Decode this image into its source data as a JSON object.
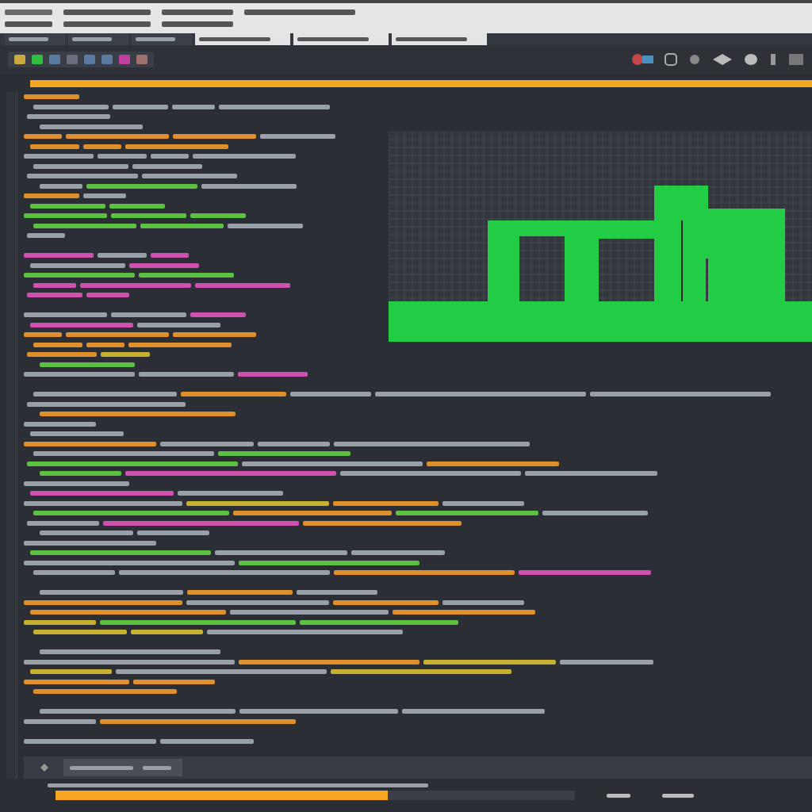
{
  "title_bar": {
    "rows": [
      {
        "segments": [
          {
            "color": "#6a6a6a"
          },
          {
            "color": "#555555"
          },
          {
            "color": "#555555"
          },
          {
            "color": "#555555"
          }
        ]
      },
      {
        "segments": [
          {
            "color": "#555555"
          },
          {
            "color": "#555555"
          },
          {
            "color": "#555555"
          }
        ]
      }
    ]
  },
  "tabs": [
    {
      "kind": "dark"
    },
    {
      "kind": "dark"
    },
    {
      "kind": "dark"
    },
    {
      "kind": "light"
    },
    {
      "kind": "light"
    },
    {
      "kind": "light"
    }
  ],
  "toolbar": {
    "buttons": [
      {
        "color": "#c8a840"
      },
      {
        "color": "#30c040"
      },
      {
        "color": "#5a7aa0"
      },
      {
        "color": "#6a6f80"
      },
      {
        "color": "#5a7aa0"
      },
      {
        "color": "#5a7aa0"
      },
      {
        "color": "#c040a0"
      },
      {
        "color": "#a07070"
      }
    ]
  },
  "editor": {
    "top_lines": [
      {
        "segments": [
          {
            "color": "#e0902a"
          }
        ]
      },
      {
        "segments": [
          {
            "color": "#9aa0a8"
          },
          {
            "color": "#9aa0a8"
          },
          {
            "color": "#9aa0a8"
          },
          {
            "color": "#9aa0a8"
          }
        ]
      },
      {
        "segments": [
          {
            "color": "#9aa0a8"
          }
        ]
      },
      {
        "segments": [
          {
            "color": "#9aa0a8"
          }
        ]
      },
      {
        "segments": [
          {
            "color": "#e0902a"
          },
          {
            "color": "#e0902a"
          },
          {
            "color": "#e0902a"
          },
          {
            "color": "#9aa0a8"
          }
        ]
      },
      {
        "segments": [
          {
            "color": "#e0902a"
          },
          {
            "color": "#e0902a"
          },
          {
            "color": "#e0902a"
          }
        ]
      },
      {
        "segments": [
          {
            "color": "#9aa0a8"
          },
          {
            "color": "#9aa0a8"
          },
          {
            "color": "#9aa0a8"
          },
          {
            "color": "#9aa0a8"
          }
        ]
      },
      {
        "segments": [
          {
            "color": "#9aa0a8"
          },
          {
            "color": "#9aa0a8"
          }
        ]
      },
      {
        "segments": [
          {
            "color": "#9aa0a8"
          },
          {
            "color": "#9aa0a8"
          }
        ]
      },
      {
        "segments": [
          {
            "color": "#9aa0a8"
          },
          {
            "color": "#5cc040"
          },
          {
            "color": "#9aa0a8"
          }
        ]
      },
      {
        "segments": [
          {
            "color": "#e0902a"
          },
          {
            "color": "#9aa0a8"
          }
        ]
      },
      {
        "segments": [
          {
            "color": "#5cc040"
          },
          {
            "color": "#5cc040"
          }
        ]
      },
      {
        "segments": [
          {
            "color": "#5cc040"
          },
          {
            "color": "#5cc040"
          },
          {
            "color": "#5cc040"
          }
        ]
      },
      {
        "segments": [
          {
            "color": "#5cc040"
          },
          {
            "color": "#5cc040"
          },
          {
            "color": "#9aa0a8"
          }
        ]
      },
      {
        "segments": [
          {
            "color": "#9aa0a8"
          }
        ]
      },
      {
        "kind": "blank"
      },
      {
        "segments": [
          {
            "color": "#d050b0"
          },
          {
            "color": "#9aa0a8"
          },
          {
            "color": "#d050b0"
          }
        ]
      },
      {
        "segments": [
          {
            "color": "#9aa0a8"
          },
          {
            "color": "#d050b0"
          }
        ]
      },
      {
        "segments": [
          {
            "color": "#5cc040"
          },
          {
            "color": "#5cc040"
          }
        ]
      },
      {
        "segments": [
          {
            "color": "#d050b0"
          },
          {
            "color": "#d050b0"
          },
          {
            "color": "#d050b0"
          }
        ]
      },
      {
        "segments": [
          {
            "color": "#d050b0"
          },
          {
            "color": "#d050b0"
          }
        ]
      },
      {
        "kind": "blank"
      },
      {
        "segments": [
          {
            "color": "#9aa0a8"
          },
          {
            "color": "#9aa0a8"
          },
          {
            "color": "#d050b0"
          }
        ]
      },
      {
        "segments": [
          {
            "color": "#d050b0"
          },
          {
            "color": "#9aa0a8"
          }
        ]
      },
      {
        "segments": [
          {
            "color": "#e0902a"
          },
          {
            "color": "#e0902a"
          },
          {
            "color": "#e0902a"
          }
        ]
      },
      {
        "segments": [
          {
            "color": "#e0902a"
          },
          {
            "color": "#e0902a"
          },
          {
            "color": "#e0902a"
          }
        ]
      },
      {
        "segments": [
          {
            "color": "#e0902a"
          },
          {
            "color": "#c8b030"
          }
        ]
      },
      {
        "segments": [
          {
            "color": "#5cc040"
          }
        ]
      },
      {
        "segments": [
          {
            "color": "#9aa0a8"
          },
          {
            "color": "#9aa0a8"
          },
          {
            "color": "#d050b0"
          }
        ]
      }
    ],
    "bottom_lines": [
      {
        "kind": "blank"
      },
      {
        "segments": [
          {
            "color": "#9aa0a8"
          },
          {
            "color": "#e0902a"
          },
          {
            "color": "#9aa0a8"
          },
          {
            "color": "#9aa0a8"
          },
          {
            "color": "#9aa0a8"
          }
        ]
      },
      {
        "segments": [
          {
            "color": "#9aa0a8"
          }
        ]
      },
      {
        "segments": [
          {
            "color": "#e0902a"
          }
        ]
      },
      {
        "segments": [
          {
            "color": "#9aa0a8"
          }
        ]
      },
      {
        "segments": [
          {
            "color": "#9aa0a8"
          }
        ]
      },
      {
        "segments": [
          {
            "color": "#e0902a"
          },
          {
            "color": "#9aa0a8"
          },
          {
            "color": "#9aa0a8"
          },
          {
            "color": "#9aa0a8"
          }
        ]
      },
      {
        "segments": [
          {
            "color": "#9aa0a8"
          },
          {
            "color": "#5cc040"
          }
        ]
      },
      {
        "segments": [
          {
            "color": "#5cc040"
          },
          {
            "color": "#9aa0a8"
          },
          {
            "color": "#e0902a"
          }
        ]
      },
      {
        "segments": [
          {
            "color": "#5cc040"
          },
          {
            "color": "#d050b0"
          },
          {
            "color": "#9aa0a8"
          },
          {
            "color": "#9aa0a8"
          }
        ]
      },
      {
        "segments": [
          {
            "color": "#9aa0a8"
          }
        ]
      },
      {
        "segments": [
          {
            "color": "#d050b0"
          },
          {
            "color": "#9aa0a8"
          }
        ]
      },
      {
        "segments": [
          {
            "color": "#9aa0a8"
          },
          {
            "color": "#c8b030"
          },
          {
            "color": "#e0902a"
          },
          {
            "color": "#9aa0a8"
          }
        ]
      },
      {
        "segments": [
          {
            "color": "#5cc040"
          },
          {
            "color": "#e0902a"
          },
          {
            "color": "#5cc040"
          },
          {
            "color": "#9aa0a8"
          }
        ]
      },
      {
        "segments": [
          {
            "color": "#9aa0a8"
          },
          {
            "color": "#d050b0"
          },
          {
            "color": "#e0902a"
          }
        ]
      },
      {
        "segments": [
          {
            "color": "#9aa0a8"
          },
          {
            "color": "#9aa0a8"
          }
        ]
      },
      {
        "segments": [
          {
            "color": "#9aa0a8"
          }
        ]
      },
      {
        "segments": [
          {
            "color": "#5cc040"
          },
          {
            "color": "#9aa0a8"
          },
          {
            "color": "#9aa0a8"
          }
        ]
      },
      {
        "segments": [
          {
            "color": "#9aa0a8"
          },
          {
            "color": "#5cc040"
          }
        ]
      },
      {
        "segments": [
          {
            "color": "#9aa0a8"
          },
          {
            "color": "#9aa0a8"
          },
          {
            "color": "#e0902a"
          },
          {
            "color": "#d050b0"
          }
        ]
      },
      {
        "kind": "blank"
      },
      {
        "segments": [
          {
            "color": "#9aa0a8"
          },
          {
            "color": "#e0902a"
          },
          {
            "color": "#9aa0a8"
          }
        ]
      },
      {
        "segments": [
          {
            "color": "#e0902a"
          },
          {
            "color": "#9aa0a8"
          },
          {
            "color": "#e0902a"
          },
          {
            "color": "#9aa0a8"
          }
        ]
      },
      {
        "segments": [
          {
            "color": "#e0902a"
          },
          {
            "color": "#9aa0a8"
          },
          {
            "color": "#e0902a"
          }
        ]
      },
      {
        "segments": [
          {
            "color": "#c8b030"
          },
          {
            "color": "#5cc040"
          },
          {
            "color": "#5cc040"
          }
        ]
      },
      {
        "segments": [
          {
            "color": "#c8b030"
          },
          {
            "color": "#c8b030"
          },
          {
            "color": "#9aa0a8"
          }
        ]
      },
      {
        "kind": "blank"
      },
      {
        "segments": [
          {
            "color": "#9aa0a8"
          }
        ]
      },
      {
        "segments": [
          {
            "color": "#9aa0a8"
          },
          {
            "color": "#e0902a"
          },
          {
            "color": "#c8b030"
          },
          {
            "color": "#9aa0a8"
          }
        ]
      },
      {
        "segments": [
          {
            "color": "#c8b030"
          },
          {
            "color": "#9aa0a8"
          },
          {
            "color": "#c8b030"
          }
        ]
      },
      {
        "segments": [
          {
            "color": "#e0902a"
          },
          {
            "color": "#e0902a"
          }
        ]
      },
      {
        "segments": [
          {
            "color": "#e0902a"
          }
        ]
      },
      {
        "kind": "blank"
      },
      {
        "segments": [
          {
            "color": "#9aa0a8"
          },
          {
            "color": "#9aa0a8"
          },
          {
            "color": "#9aa0a8"
          }
        ]
      },
      {
        "segments": [
          {
            "color": "#9aa0a8"
          },
          {
            "color": "#e0902a"
          }
        ]
      },
      {
        "kind": "blank"
      },
      {
        "segments": [
          {
            "color": "#9aa0a8"
          },
          {
            "color": "#9aa0a8"
          }
        ]
      }
    ]
  },
  "status": {
    "progress": {
      "level": 0.64
    }
  }
}
